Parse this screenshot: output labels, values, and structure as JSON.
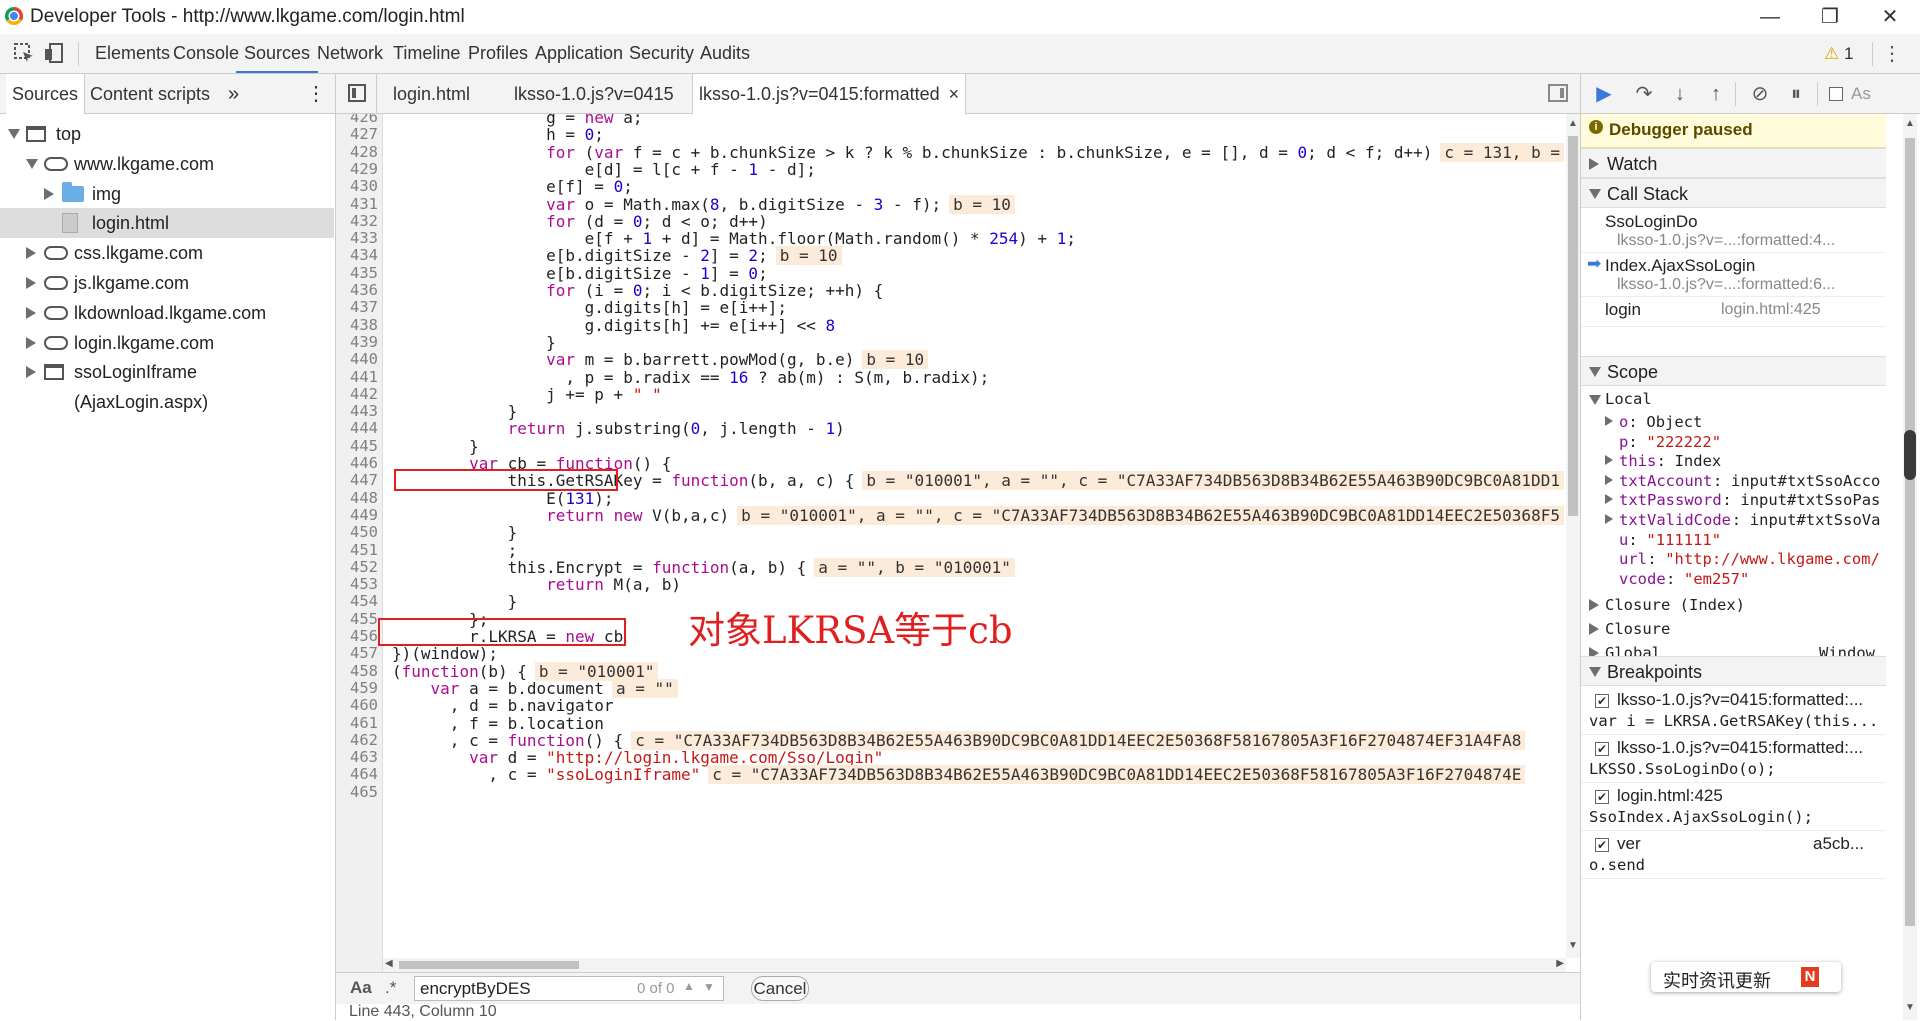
{
  "window": {
    "title": "Developer Tools - http://www.lkgame.com/login.html",
    "controls": [
      "—",
      "❐",
      "✕"
    ]
  },
  "toolbar": {
    "tabs": [
      "Elements",
      "Console",
      "Sources",
      "Network",
      "Timeline",
      "Profiles",
      "Application",
      "Security",
      "Audits"
    ],
    "active_tab": "Sources",
    "warning_count": "1",
    "warning_icon": "warning-triangle",
    "accent_color": "#3879d9"
  },
  "navigator": {
    "tabs": [
      "Sources",
      "Content scripts"
    ],
    "more": "»",
    "menu": "⋮",
    "tree": [
      {
        "label": "top",
        "level": 0,
        "icon": "frame",
        "expanded": true
      },
      {
        "label": "www.lkgame.com",
        "level": 1,
        "icon": "cloud",
        "expanded": true
      },
      {
        "label": "img",
        "level": 2,
        "icon": "folder",
        "expanded": false
      },
      {
        "label": "login.html",
        "level": 2,
        "icon": "file",
        "selected": true
      },
      {
        "label": "css.lkgame.com",
        "level": 1,
        "icon": "cloud",
        "expanded": false
      },
      {
        "label": "js.lkgame.com",
        "level": 1,
        "icon": "cloud",
        "expanded": false
      },
      {
        "label": "lkdownload.lkgame.com",
        "level": 1,
        "icon": "cloud",
        "expanded": false
      },
      {
        "label": "login.lkgame.com",
        "level": 1,
        "icon": "cloud",
        "expanded": false
      },
      {
        "label": "ssoLoginIframe (AjaxLogin.aspx)",
        "level": 1,
        "icon": "frame",
        "expanded": false
      }
    ]
  },
  "editor": {
    "tabs": [
      "login.html",
      "lksso-1.0.js?v=0415",
      "lksso-1.0.js?v=0415:formatted"
    ],
    "active_tab": "lksso-1.0.js?v=0415:formatted",
    "close_glyph": "×",
    "lines": [
      {
        "n": "426",
        "code": "                g = new a;",
        "eval": ""
      },
      {
        "n": "427",
        "code": "                h = 0;",
        "eval": ""
      },
      {
        "n": "428",
        "code": "                for (var f = c + b.chunkSize > k ? k % b.chunkSize : b.chunkSize, e = [], d = 0; d < f; d++)",
        "eval": "c = 131, b ="
      },
      {
        "n": "429",
        "code": "                    e[d] = l[c + f - 1 - d];",
        "eval": ""
      },
      {
        "n": "430",
        "code": "                e[f] = 0;",
        "eval": ""
      },
      {
        "n": "431",
        "code": "                var o = Math.max(8, b.digitSize - 3 - f);",
        "eval": "b = 10"
      },
      {
        "n": "432",
        "code": "                for (d = 0; d < o; d++)",
        "eval": ""
      },
      {
        "n": "433",
        "code": "                    e[f + 1 + d] = Math.floor(Math.random() * 254) + 1;",
        "eval": ""
      },
      {
        "n": "434",
        "code": "                e[b.digitSize - 2] = 2;",
        "eval": "b = 10"
      },
      {
        "n": "435",
        "code": "                e[b.digitSize - 1] = 0;",
        "eval": ""
      },
      {
        "n": "436",
        "code": "                for (i = 0; i < b.digitSize; ++h) {",
        "eval": ""
      },
      {
        "n": "437",
        "code": "                    g.digits[h] = e[i++];",
        "eval": ""
      },
      {
        "n": "438",
        "code": "                    g.digits[h] += e[i++] << 8",
        "eval": ""
      },
      {
        "n": "439",
        "code": "                }",
        "eval": ""
      },
      {
        "n": "440",
        "code": "                var m = b.barrett.powMod(g, b.e)",
        "eval": "b = 10"
      },
      {
        "n": "441",
        "code": "                  , p = b.radix == 16 ? ab(m) : S(m, b.radix);",
        "eval": ""
      },
      {
        "n": "442",
        "code": "                j += p + \" \"",
        "eval": ""
      },
      {
        "n": "443",
        "code": "            }",
        "eval": ""
      },
      {
        "n": "444",
        "code": "            return j.substring(0, j.length - 1)",
        "eval": ""
      },
      {
        "n": "445",
        "code": "        }",
        "eval": ""
      },
      {
        "n": "446",
        "code": "        var cb = function() {",
        "eval": ""
      },
      {
        "n": "447",
        "code": "            this.GetRSAKey = function(b, a, c) {",
        "eval": "b = \"010001\", a = \"\", c = \"C7A33AF734DB563D8B34B62E55A463B90DC9BC0A81DD1"
      },
      {
        "n": "448",
        "code": "                E(131);",
        "eval": ""
      },
      {
        "n": "449",
        "code": "                return new V(b,a,c)",
        "eval": "b = \"010001\", a = \"\", c = \"C7A33AF734DB563D8B34B62E55A463B90DC9BC0A81DD14EEC2E50368F5"
      },
      {
        "n": "450",
        "code": "            }",
        "eval": ""
      },
      {
        "n": "451",
        "code": "            ;",
        "eval": ""
      },
      {
        "n": "452",
        "code": "            this.Encrypt = function(a, b) {",
        "eval": "a = \"\", b = \"010001\""
      },
      {
        "n": "453",
        "code": "                return M(a, b)",
        "eval": ""
      },
      {
        "n": "454",
        "code": "            }",
        "eval": ""
      },
      {
        "n": "455",
        "code": "        };",
        "eval": ""
      },
      {
        "n": "456",
        "code": "        r.LKRSA = new cb",
        "eval": ""
      },
      {
        "n": "457",
        "code": "})(window);",
        "eval": ""
      },
      {
        "n": "458",
        "code": "(function(b) {",
        "eval": "b = \"010001\""
      },
      {
        "n": "459",
        "code": "    var a = b.document",
        "eval": "a = \"\""
      },
      {
        "n": "460",
        "code": "      , d = b.navigator",
        "eval": ""
      },
      {
        "n": "461",
        "code": "      , f = b.location",
        "eval": ""
      },
      {
        "n": "462",
        "code": "      , c = function() {",
        "eval": "c = \"C7A33AF734DB563D8B34B62E55A463B90DC9BC0A81DD14EEC2E50368F58167805A3F16F2704874EF31A4FA8"
      },
      {
        "n": "463",
        "code": "        var d = \"http://login.lkgame.com/Sso/Login\"",
        "eval": ""
      },
      {
        "n": "464",
        "code": "          , c = \"ssoLoginIframe\"",
        "eval": "c = \"C7A33AF734DB563D8B34B62E55A463B90DC9BC0A81DD14EEC2E50368F58167805A3F16F2704874E"
      },
      {
        "n": "465",
        "code": "",
        "eval": ""
      }
    ],
    "annotation": "对象LKRSA等于cb",
    "annotation_color": "#e02020"
  },
  "search": {
    "case_label": "Aa",
    "regex_label": ".*",
    "query": "encryptByDES",
    "match_count": "0 of 0",
    "cancel_label": "Cancel"
  },
  "status": {
    "position": "Line 443, Column 10"
  },
  "debugger": {
    "paused_label": "Debugger paused",
    "async_label": "As",
    "sections": {
      "watch": "Watch",
      "call_stack": "Call Stack",
      "scope": "Scope",
      "breakpoints": "Breakpoints"
    },
    "call_stack": [
      {
        "fn": "SsoLoginDo",
        "loc": "lksso-1.0.js?v=...:formatted:4..."
      },
      {
        "fn": "Index.AjaxSsoLogin",
        "loc": "lksso-1.0.js?v=...:formatted:6..."
      },
      {
        "fn": "login",
        "loc": "login.html:425"
      }
    ],
    "scope": {
      "local_label": "Local",
      "vars": [
        {
          "name": "o",
          "value": "Object",
          "expandable": true,
          "kind": "obj"
        },
        {
          "name": "p",
          "value": "\"222222\"",
          "expandable": false,
          "kind": "str"
        },
        {
          "name": "this",
          "value": "Index",
          "expandable": true,
          "kind": "obj"
        },
        {
          "name": "txtAccount",
          "value": "input#txtSsoAcco",
          "expandable": true,
          "kind": "obj"
        },
        {
          "name": "txtPassword",
          "value": "input#txtSsoPas",
          "expandable": true,
          "kind": "obj"
        },
        {
          "name": "txtValidCode",
          "value": "input#txtSsoVa",
          "expandable": true,
          "kind": "obj"
        },
        {
          "name": "u",
          "value": "\"111111\"",
          "expandable": false,
          "kind": "str"
        },
        {
          "name": "url",
          "value": "\"http://www.lkgame.com/",
          "expandable": false,
          "kind": "str"
        },
        {
          "name": "vcode",
          "value": "\"em257\"",
          "expandable": false,
          "kind": "str"
        }
      ],
      "closures": [
        "Closure (Index)",
        "Closure"
      ],
      "global_label": "Global",
      "global_value": "Window"
    },
    "breakpoints": [
      {
        "file": "lksso-1.0.js?v=0415:formatted:...",
        "code": "var i = LKRSA.GetRSAKey(this..."
      },
      {
        "file": "lksso-1.0.js?v=0415:formatted:...",
        "code": "LKSSO.SsoLoginDo(o);"
      },
      {
        "file": "login.html:425",
        "code": "SsoIndex.AjaxSsoLogin();"
      },
      {
        "file": "ver",
        "code": "o.send",
        "file_tail": "a5cb..."
      }
    ],
    "toast": "实时资讯更新",
    "toast_badge": "N"
  }
}
